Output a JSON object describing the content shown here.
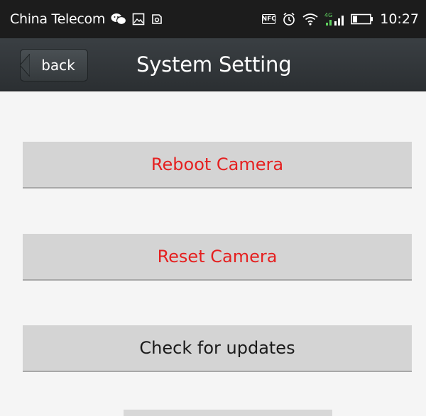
{
  "status_bar": {
    "carrier": "China Telecom",
    "time": "10:27",
    "left_icons": [
      "wechat-icon",
      "image-icon",
      "gallery-icon"
    ],
    "right_icons": [
      "nfc-icon",
      "alarm-icon",
      "wifi-icon",
      "signal-icon",
      "battery-icon"
    ],
    "nfc_label": "NFC",
    "network_badge": "4G"
  },
  "title_bar": {
    "back_label": "back",
    "title": "System Setting"
  },
  "menu": {
    "items": [
      {
        "label": "Reboot Camera",
        "color": "#e52020"
      },
      {
        "label": "Reset Camera",
        "color": "#e52020"
      },
      {
        "label": "Check for updates",
        "color": "#1a1a1a"
      }
    ]
  },
  "colors": {
    "status_bar_bg": "#1c1c1c",
    "title_bar_bg": "#32373a",
    "page_bg": "#f5f5f5",
    "button_bg": "#d4d4d4",
    "warning_text": "#e52020",
    "network_badge": "#5fd35f"
  }
}
